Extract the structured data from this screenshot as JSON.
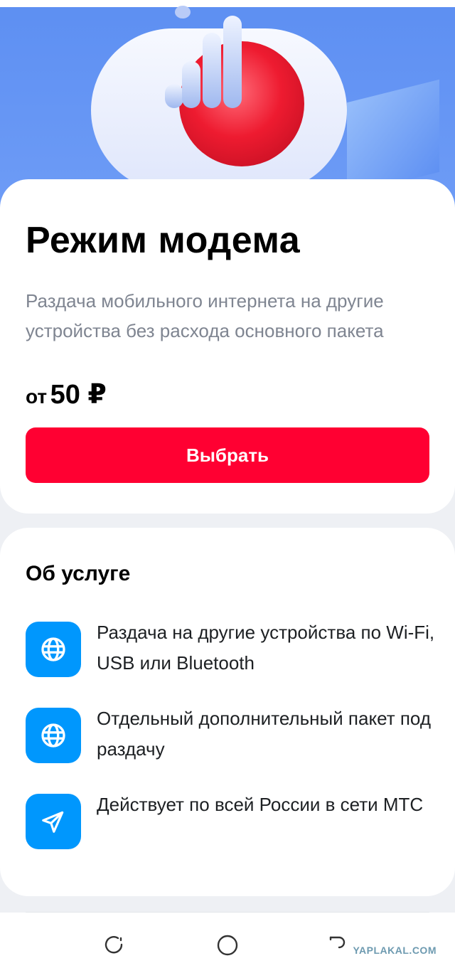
{
  "hero": {
    "image": "signal-bars-modem-illustration"
  },
  "main": {
    "title": "Режим модема",
    "subtitle": "Раздача мобильного интернета на другие устройства без расхода основного пакета",
    "price_prefix": "от",
    "price_value": "50 ₽",
    "select_label": "Выбрать"
  },
  "about": {
    "title": "Об услуге",
    "features": [
      {
        "icon": "globe-icon",
        "text": "Раздача на другие устройства по Wi-Fi, USB или Bluetooth"
      },
      {
        "icon": "globe-icon",
        "text": "Отдельный дополнительный пакет под раздачу"
      },
      {
        "icon": "send-icon",
        "text": "Действует по всей России в сети МТС"
      }
    ]
  },
  "navbar": {
    "items": [
      "recents",
      "home",
      "back"
    ]
  },
  "watermark": "YAPLAKAL.COM",
  "colors": {
    "accent": "#ff0032",
    "icon_bg": "#0097fd",
    "hero_bg": "#5d8ff2",
    "secondary_text": "#7f8591"
  }
}
